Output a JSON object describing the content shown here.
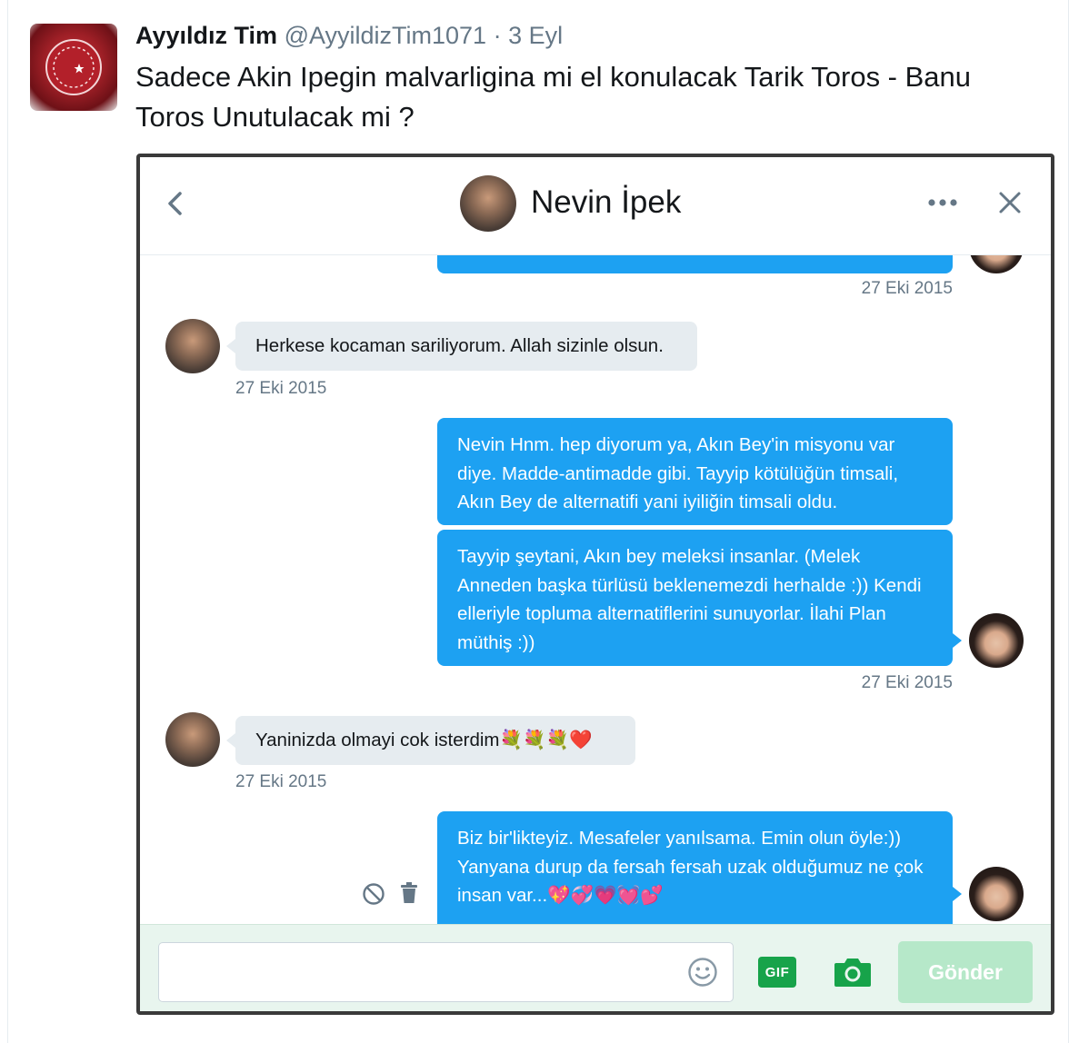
{
  "tweet": {
    "author_name": "Ayyıldız Tim",
    "handle": "@AyyildizTim1071",
    "separator": "·",
    "date": "3 Eyl",
    "text": "Sadece Akin Ipegin malvarligina mi el konulacak Tarik Toros - Banu Toros Unutulacak mi ?"
  },
  "dm": {
    "contact_name": "Nevin İpek",
    "messages": [
      {
        "direction": "out",
        "text": "",
        "time": "27 Eki 2015"
      },
      {
        "direction": "in",
        "text": "Herkese kocaman sariliyorum. Allah sizinle olsun.",
        "time": "27 Eki 2015"
      },
      {
        "direction": "out",
        "text": "Nevin Hnm. hep diyorum ya, Akın Bey'in misyonu var diye. Madde-antimadde gibi. Tayyip kötülüğün timsali, Akın Bey de alternatifi yani iyiliğin timsali oldu."
      },
      {
        "direction": "out",
        "text": "Tayyip şeytani, Akın bey meleksi insanlar. (Melek Anneden başka türlüsü beklenemezdi herhalde :)) Kendi elleriyle topluma alternatiflerini sunuyorlar. İlahi Plan müthiş :))",
        "time": "27 Eki 2015"
      },
      {
        "direction": "in",
        "text": "Yaninizda olmayi cok isterdim💐💐💐❤️",
        "time": "27 Eki 2015"
      },
      {
        "direction": "out",
        "text": "Biz bir'likteyiz. Mesafeler yanılsama. Emin olun öyle:)) Yanyana durup da fersah fersah uzak olduğumuz ne çok insan var...💖💞💗💓💕"
      }
    ],
    "composer": {
      "placeholder": "",
      "gif_label": "GIF",
      "send_label": "Gönder"
    }
  },
  "icons": {
    "back": "chevron-left-icon",
    "more": "more-horizontal-icon",
    "close": "close-icon",
    "report": "block-icon",
    "delete": "trash-icon",
    "emoji": "emoji-icon",
    "camera": "camera-icon"
  },
  "colors": {
    "outgoing_bubble": "#1da1f2",
    "incoming_bubble": "#e6ecf0",
    "footer_bg": "#e8f5ee",
    "gif_green": "#17a34a",
    "send_disabled": "#b6e8c9",
    "secondary_text": "#657786"
  }
}
